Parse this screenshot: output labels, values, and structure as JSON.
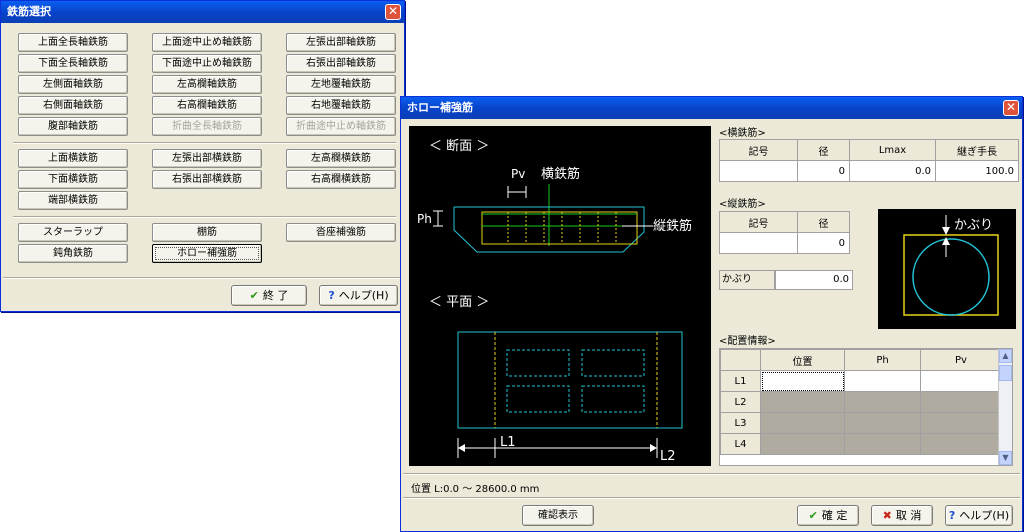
{
  "left_window": {
    "title": "鉄筋選択",
    "close": "✕",
    "axial_buttons": [
      [
        "上面全長軸鉄筋",
        "上面途中止め軸鉄筋",
        "左張出部軸鉄筋"
      ],
      [
        "下面全長軸鉄筋",
        "下面途中止め軸鉄筋",
        "右張出部軸鉄筋"
      ],
      [
        "左側面軸鉄筋",
        "左高欄軸鉄筋",
        "左地覆軸鉄筋"
      ],
      [
        "右側面軸鉄筋",
        "右高欄軸鉄筋",
        "右地覆軸鉄筋"
      ],
      [
        "腹部軸鉄筋",
        "折曲全長軸鉄筋",
        "折曲途中止め軸鉄筋"
      ]
    ],
    "transverse_buttons": [
      [
        "上面横鉄筋",
        "左張出部横鉄筋",
        "左高欄横鉄筋"
      ],
      [
        "下面横鉄筋",
        "右張出部横鉄筋",
        "右高欄横鉄筋"
      ],
      [
        "端部横鉄筋",
        "",
        ""
      ]
    ],
    "other_buttons": [
      [
        "スターラップ",
        "棚筋",
        "沓座補強筋"
      ],
      [
        "鈍角鉄筋",
        "ホロー補強筋",
        ""
      ]
    ],
    "end_button": "終 了",
    "help_button": "ヘルプ(H)"
  },
  "right_window": {
    "title": "ホロー補強筋",
    "close": "✕",
    "diagram": {
      "section_label": "＜ 断面 ＞",
      "plan_label": "＜ 平面 ＞",
      "pv": "Pv",
      "ph": "Ph",
      "transverse": "横鉄筋",
      "longitudinal": "縦鉄筋",
      "l1": "L1",
      "l2": "L2"
    },
    "transverse_section": {
      "label": "<横鉄筋>",
      "headers": [
        "記号",
        "径",
        "Lmax",
        "継ぎ手長"
      ],
      "values": [
        "",
        "0",
        "0.0",
        "100.0"
      ]
    },
    "longitudinal_section": {
      "label": "<縦鉄筋>",
      "headers": [
        "記号",
        "径"
      ],
      "values": [
        "",
        "0"
      ]
    },
    "cover": {
      "label": "かぶり",
      "value": "0.0",
      "diagram_label": "かぶり"
    },
    "placement": {
      "label": "<配置情報>",
      "headers": [
        "位置",
        "Ph",
        "Pv"
      ],
      "rows": [
        "L1",
        "L2",
        "L3",
        "L4"
      ]
    },
    "status": "位置 L:0.0 ～  28600.0 mm",
    "confirm_display": "確認表示",
    "ok": "確 定",
    "cancel": "取 消",
    "help": "ヘルプ(H)"
  }
}
